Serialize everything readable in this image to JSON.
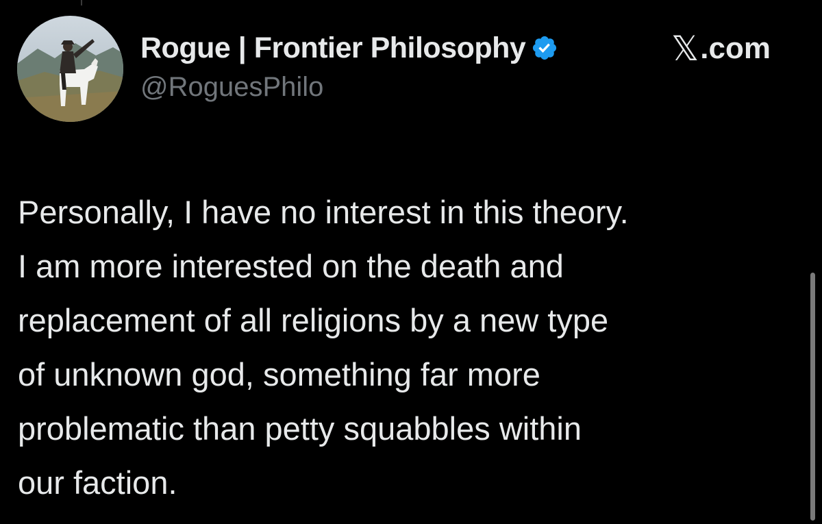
{
  "tweet": {
    "author": {
      "display_name": "Rogue | Frontier Philosophy",
      "handle": "@RoguesPhilo",
      "verified": true,
      "verified_color": "#1d9bf0",
      "avatar_icon": "profile-photo-rider-on-white-horse"
    },
    "source": {
      "logo_glyph": "𝕏",
      "label": ".com"
    },
    "text": "Personally, I have no interest in this theory.\nI am more interested on the death and\nreplacement of all religions by a new type\nof unknown god, something far more\nproblematic than petty squabbles within\nour faction."
  },
  "theme": {
    "background": "#000000",
    "text_color": "#e7e9ea",
    "secondary_text_color": "#71767b"
  }
}
